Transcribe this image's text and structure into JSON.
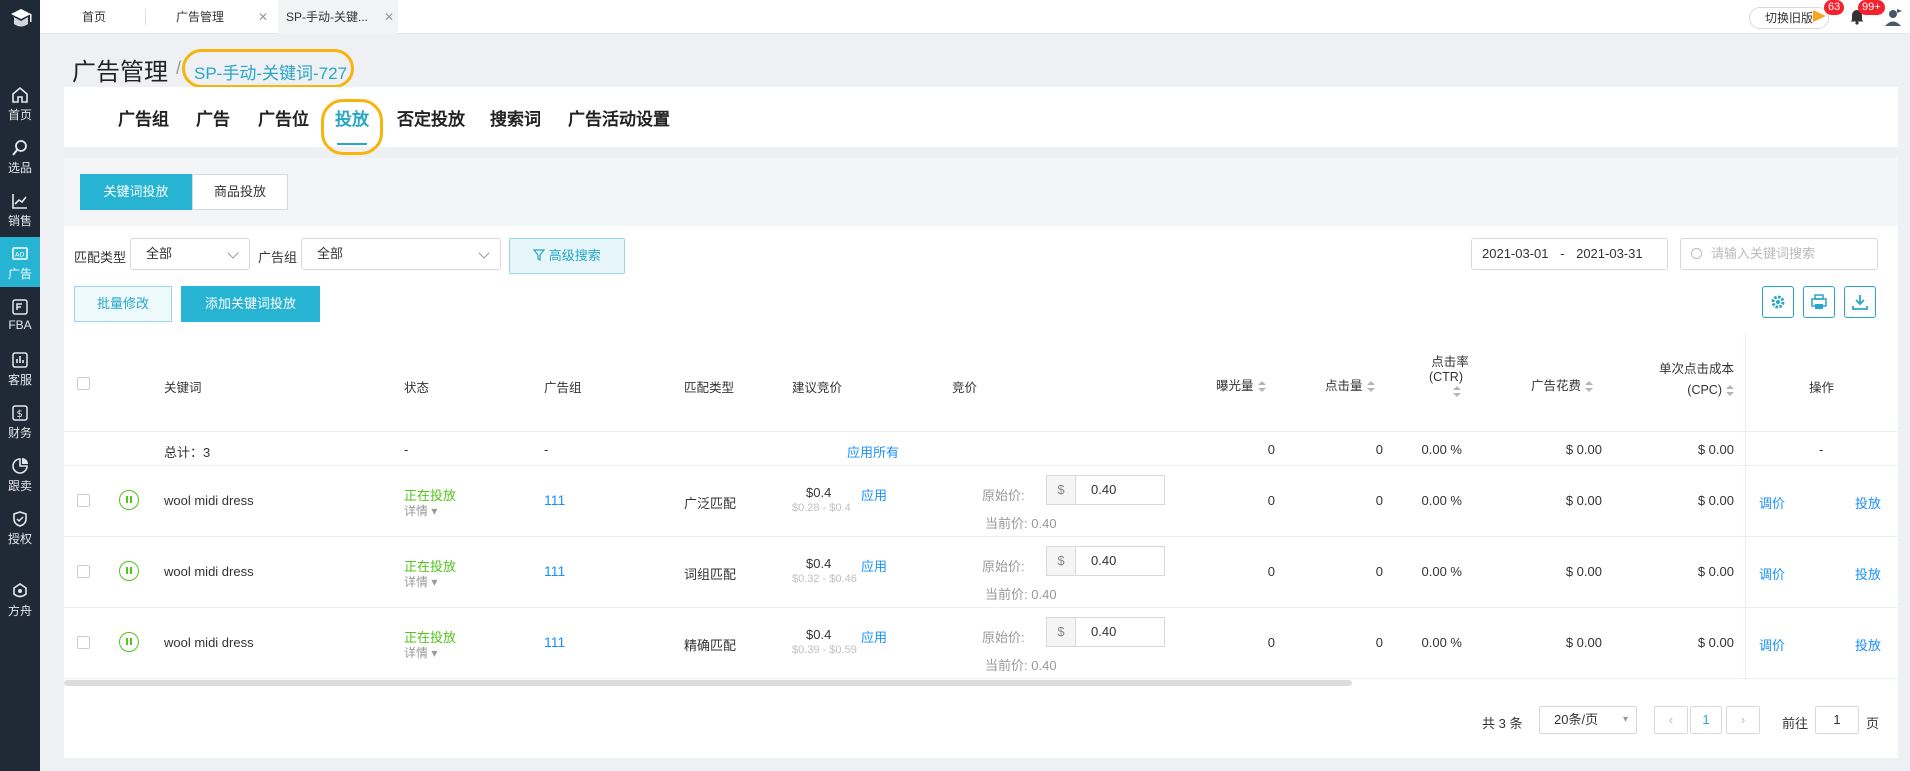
{
  "colors": {
    "accent": "#27b3d2",
    "highlight": "#f5b50e",
    "green": "#52c41a",
    "link": "#1890ff",
    "sidebar": "#1f2a36"
  },
  "sidebar": {
    "items": [
      {
        "label": "首页",
        "icon": "home-icon"
      },
      {
        "label": "选品",
        "icon": "search-icon"
      },
      {
        "label": "销售",
        "icon": "chart-line-icon"
      },
      {
        "label": "广告",
        "icon": "ad-icon"
      },
      {
        "label": "FBA",
        "icon": "fba-icon"
      },
      {
        "label": "客服",
        "icon": "service-icon"
      },
      {
        "label": "财务",
        "icon": "finance-icon"
      },
      {
        "label": "跟卖",
        "icon": "pie-icon"
      },
      {
        "label": "授权",
        "icon": "shield-icon"
      },
      {
        "label": "方舟",
        "icon": "ark-icon"
      }
    ]
  },
  "topbar": {
    "tabs": [
      "首页",
      "广告管理",
      "SP-手动-关键..."
    ],
    "old_version": "切换旧版",
    "flag_badge": "63",
    "bell_badge": "99+"
  },
  "header": {
    "title": "广告管理",
    "slash": "/",
    "campaign": "SP-手动-关键词-727"
  },
  "main_tabs": [
    "广告组",
    "广告",
    "广告位",
    "投放",
    "否定投放",
    "搜索词",
    "广告活动设置"
  ],
  "segments": [
    "关键词投放",
    "商品投放"
  ],
  "filters": {
    "match_label": "匹配类型",
    "match_value": "全部",
    "group_label": "广告组",
    "group_value": "全部",
    "advanced": "高级搜索",
    "date_start": "2021-03-01",
    "date_sep": "-",
    "date_end": "2021-03-31",
    "search_placeholder": "请输入关键词搜索"
  },
  "actions": {
    "batch": "批量修改",
    "add": "添加关键词投放"
  },
  "table": {
    "headers": {
      "keyword": "关键词",
      "status": "状态",
      "group": "广告组",
      "match": "匹配类型",
      "suggested": "建议竞价",
      "bid": "竞价",
      "impressions": "曝光量",
      "clicks": "点击量",
      "ctr_1": "点击率",
      "ctr_2": "(CTR)",
      "spend": "广告花费",
      "cpc_1": "单次点击成本",
      "cpc_2": "(CPC)",
      "ops": "操作"
    },
    "summary": {
      "label": "总计：3",
      "status": "-",
      "group": "-",
      "apply_all": "应用所有",
      "impressions": "0",
      "clicks": "0",
      "ctr": "0.00 %",
      "spend": "$ 0.00",
      "cpc": "$ 0.00",
      "ops": "-"
    },
    "rows": [
      {
        "keyword": "wool midi dress",
        "status": "正在投放",
        "detail": "详情",
        "group": "111",
        "match": "广泛匹配",
        "suggested": "$0.4",
        "range": "$0.28 - $0.4",
        "apply": "应用",
        "orig_label": "原始价:",
        "currency": "$",
        "bid": "0.40",
        "cur_label": "当前价:",
        "cur_bid": "0.40",
        "impressions": "0",
        "clicks": "0",
        "ctr": "0.00 %",
        "spend": "$ 0.00",
        "cpc": "$ 0.00",
        "op1": "调价",
        "op2": "投放"
      },
      {
        "keyword": "wool midi dress",
        "status": "正在投放",
        "detail": "详情",
        "group": "111",
        "match": "词组匹配",
        "suggested": "$0.4",
        "range": "$0.32 - $0.46",
        "apply": "应用",
        "orig_label": "原始价:",
        "currency": "$",
        "bid": "0.40",
        "cur_label": "当前价:",
        "cur_bid": "0.40",
        "impressions": "0",
        "clicks": "0",
        "ctr": "0.00 %",
        "spend": "$ 0.00",
        "cpc": "$ 0.00",
        "op1": "调价",
        "op2": "投放"
      },
      {
        "keyword": "wool midi dress",
        "status": "正在投放",
        "detail": "详情",
        "group": "111",
        "match": "精确匹配",
        "suggested": "$0.4",
        "range": "$0.39 - $0.59",
        "apply": "应用",
        "orig_label": "原始价:",
        "currency": "$",
        "bid": "0.40",
        "cur_label": "当前价:",
        "cur_bid": "0.40",
        "impressions": "0",
        "clicks": "0",
        "ctr": "0.00 %",
        "spend": "$ 0.00",
        "cpc": "$ 0.00",
        "op1": "调价",
        "op2": "投放"
      }
    ]
  },
  "pagination": {
    "total": "共 3 条",
    "page_size": "20条/页",
    "current": "1",
    "goto_label": "前往",
    "goto_value": "1",
    "page_suffix": "页"
  }
}
